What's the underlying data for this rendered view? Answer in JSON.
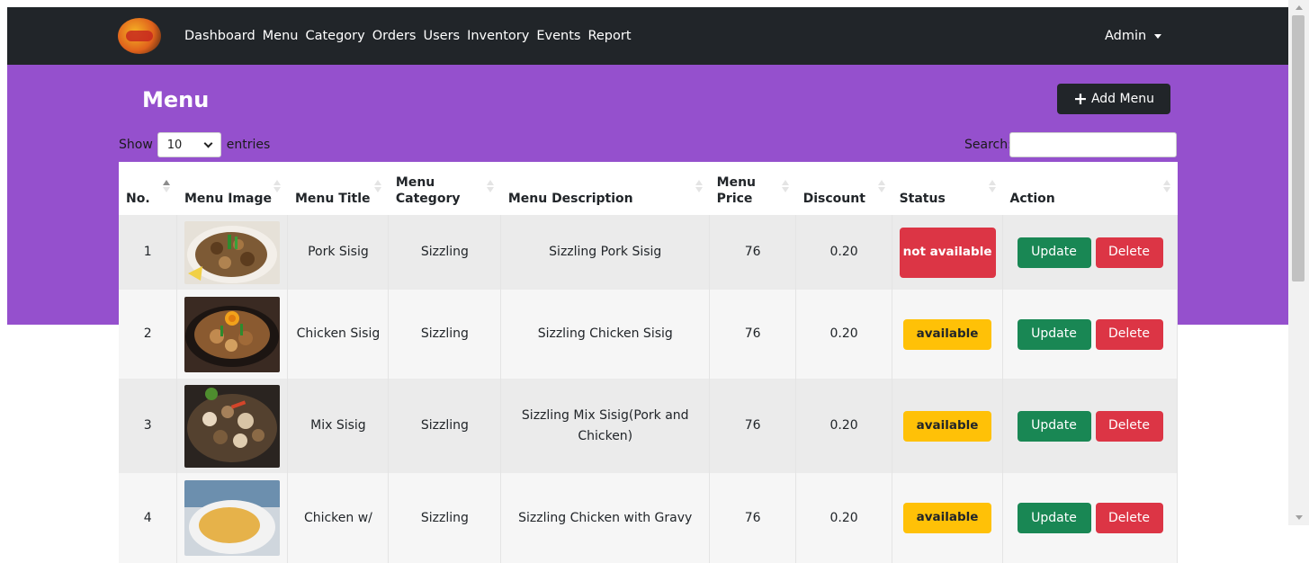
{
  "navbar": {
    "links": [
      "Dashboard",
      "Menu",
      "Category",
      "Orders",
      "Users",
      "Inventory",
      "Events",
      "Report"
    ],
    "user_label": "Admin"
  },
  "page": {
    "title": "Menu",
    "add_button_label": "Add Menu"
  },
  "table_controls": {
    "show_label": "Show",
    "entries_value": "10",
    "entries_label": "entries",
    "search_label": "Search:",
    "search_value": ""
  },
  "table": {
    "headers": [
      "No.",
      "Menu Image",
      "Menu Title",
      "Menu Category",
      "Menu Description",
      "Menu Price",
      "Discount",
      "Status",
      "Action"
    ],
    "sorted_column": "No.",
    "rows": [
      {
        "no": "1",
        "title": "Pork Sisig",
        "category": "Sizzling",
        "description": "Sizzling Pork Sisig",
        "price": "76",
        "discount": "0.20",
        "status": "not available"
      },
      {
        "no": "2",
        "title": "Chicken Sisig",
        "category": "Sizzling",
        "description": "Sizzling Chicken Sisig",
        "price": "76",
        "discount": "0.20",
        "status": "available"
      },
      {
        "no": "3",
        "title": "Mix Sisig",
        "category": "Sizzling",
        "description": "Sizzling Mix Sisig(Pork and Chicken)",
        "price": "76",
        "discount": "0.20",
        "status": "available"
      },
      {
        "no": "4",
        "title": "Chicken w/",
        "category": "Sizzling",
        "description": "Sizzling Chicken with Gravy",
        "price": "76",
        "discount": "0.20",
        "status": "available"
      }
    ],
    "update_label": "Update",
    "delete_label": "Delete"
  },
  "colors": {
    "navbar": "#212529",
    "banner": "#9550cd",
    "update": "#198754",
    "delete": "#dc3545",
    "not_available": "#dc3545",
    "available": "#ffc107"
  }
}
